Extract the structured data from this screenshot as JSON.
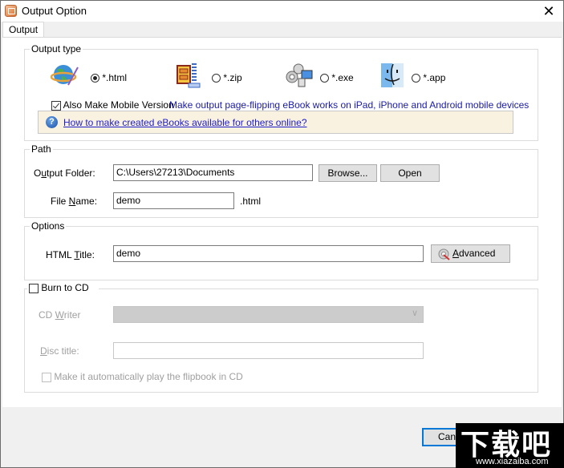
{
  "window": {
    "title": "Output Option",
    "close_icon": "close-x-icon"
  },
  "tabs": [
    {
      "label": "Output",
      "active": true
    }
  ],
  "output_type": {
    "legend": "Output type",
    "options": [
      {
        "label": "*.html",
        "icon": "globe-html-icon",
        "selected": true
      },
      {
        "label": "*.zip",
        "icon": "zip-archive-icon",
        "selected": false
      },
      {
        "label": "*.exe",
        "icon": "gears-computer-icon",
        "selected": false
      },
      {
        "label": "*.app",
        "icon": "mac-finder-icon",
        "selected": false
      }
    ],
    "mobile_checkbox": {
      "label": "Also Make Mobile Version",
      "checked": true
    },
    "mobile_description": "Make output page-flipping eBook works on iPad, iPhone and Android mobile devices",
    "help_link": "How to make created eBooks available for others online?"
  },
  "path": {
    "legend": "Path",
    "output_folder_label": "Output Folder:",
    "output_folder_value": "C:\\Users\\27213\\Documents",
    "browse_label": "Browse...",
    "open_label": "Open",
    "file_name_label": "File Name:",
    "file_name_value": "demo",
    "extension": ".html"
  },
  "options": {
    "legend": "Options",
    "html_title_label": "HTML Title:",
    "html_title_value": "demo",
    "advanced_label": "Advanced"
  },
  "burn_cd": {
    "checkbox_label": "Burn to CD",
    "checked": false,
    "cd_writer_label": "CD Writer",
    "cd_writer_value": "",
    "disc_title_label": "Disc title:",
    "disc_title_value": "",
    "autoplay_label": "Make it automatically play the flipbook in CD",
    "autoplay_checked": false
  },
  "footer": {
    "cancel_label": "Cancel"
  },
  "watermark": {
    "text": "下载吧",
    "url": "www.xiazaiba.com"
  }
}
